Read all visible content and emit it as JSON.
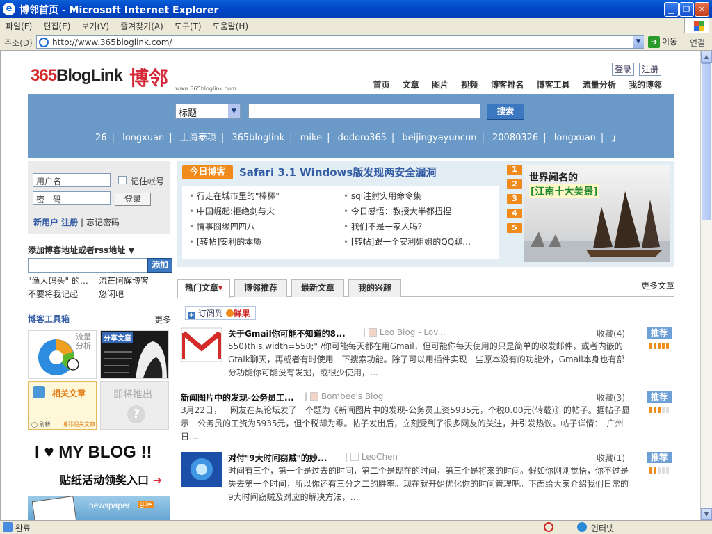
{
  "window": {
    "title": "博邻首页 - Microsoft Internet Explorer"
  },
  "menu": [
    "파일(F)",
    "편집(E)",
    "보기(V)",
    "즐겨찾기(A)",
    "도구(T)",
    "도움말(H)"
  ],
  "address": {
    "label": "주소(D)",
    "url": "http://www.365bloglink.com/",
    "go": "이동",
    "links": "연결"
  },
  "status": {
    "text": "완료",
    "zone": "인터넷"
  },
  "header": {
    "logo_text": "365BlogLink",
    "logo_han": "博邻",
    "logo_url": "www.365bloglink.com",
    "login": "登录",
    "register": "注册",
    "nav": [
      "首页",
      "文章",
      "图片",
      "视频",
      "博客排名",
      "博客工具",
      "流量分析",
      "我的博邻"
    ]
  },
  "search": {
    "select": "标题",
    "button": "搜索",
    "tags": [
      "26",
      "longxuan",
      "上海泰项",
      "365bloglink",
      "mike",
      "dodoro365",
      "beijingyayuncun",
      "20080326",
      "longxuan",
      "」"
    ]
  },
  "login": {
    "username": "用户名",
    "password": "密　码",
    "remember": "记住帐号",
    "login_btn": "登录",
    "new_user": "新用户 注册",
    "forgot": "忘记密码"
  },
  "rss": {
    "label": "添加博客地址或者rss地址 ▼",
    "button": "添加",
    "recent": [
      "\"渔人码头\" 的…",
      "流芒阿辉博客",
      "不要将我记起",
      "悠闲吧"
    ]
  },
  "toolbox": {
    "title": "博客工具箱",
    "more": "更多",
    "tile1": "流量分析",
    "tile2": "分享文章",
    "tile3": "相关文章",
    "tile3_refresh": "◯ 刷新",
    "tile3_foot": "博邻相关文章",
    "tile4": "即将推出"
  },
  "banners": {
    "blog": "I ♥ MY BLOG !!",
    "blog_sub": "贴纸活动领奖入口",
    "blog_arrow": "➜",
    "newspaper": "newspaper",
    "go": "go▸"
  },
  "featured": {
    "badge": "今日博客",
    "headline": "Safari 3.1 Windows版发现两安全漏洞",
    "left": [
      "行走在城市里的\"棒棒\"",
      "中国崛起:拒绝剑与火",
      "情事囧缘四四八",
      "[转帖]安利的本质"
    ],
    "right": [
      "sql注射实用命令集",
      "今日感悟：教授大半都扭捏",
      "我们不是一家人吗？",
      "[转帖]跟一个安利姐姐的QQ聊…"
    ],
    "nums": [
      "1",
      "2",
      "3",
      "4",
      "5"
    ],
    "pic_caption1": "世界闻名的",
    "pic_caption2": "[江南十大美景]"
  },
  "tabs": {
    "items": [
      "热门文章",
      "博邻推荐",
      "最新文章",
      "我的兴趣"
    ],
    "more": "更多文章",
    "active_arrow": "▾"
  },
  "subscribe": {
    "prefix": "订阅到",
    "brand": "鲜果"
  },
  "posts": [
    {
      "title": "关于Gmail你可能不知道的8...",
      "author": "Leo Blog - Lov...",
      "fav": "收藏(4)",
      "rec": "推荐",
      "level": 5,
      "desc": "550)this.width=550;\" /你可能每天都在用Gmail，但可能你每天使用的只是简单的收发邮件，或者内嵌的Gtalk聊天，再或者有时使用一下搜索功能。除了可以用插件实现一些原本没有的功能外，Gmail本身也有部分功能你可能没有发掘，或很少使用，…"
    },
    {
      "title": "新闻图片中的发现-公务员工...",
      "author": "Bombee's Blog",
      "fav": "收藏(3)",
      "rec": "推荐",
      "level": 3,
      "desc": "3月22日，一网友在某论坛发了一个题为《新闻图片中的发现-公务员工资5935元，个税0.00元(转载)》的帖子。据帖子显示一公务员的工资为5935元，但个税却为零。帖子发出后，立刻受到了很多网友的关注，并引发热议。帖子详情：　广州日…"
    },
    {
      "title": "对付\"9大时间窃贼\"的妙...",
      "author": "LeoChen",
      "fav": "收藏(1)",
      "rec": "推荐",
      "level": 2,
      "desc": "时间有三个，第一个是过去的时间，第二个是现在的时间，第三个是将来的时间。假如你刚刚觉悟，你不过是失去第一个时间，所以你还有三分之二的胜率。现在就开始优化你的时间管理吧。下面给大家介绍我们日常的9大时间窃贼及对应的解决方法，…"
    }
  ]
}
